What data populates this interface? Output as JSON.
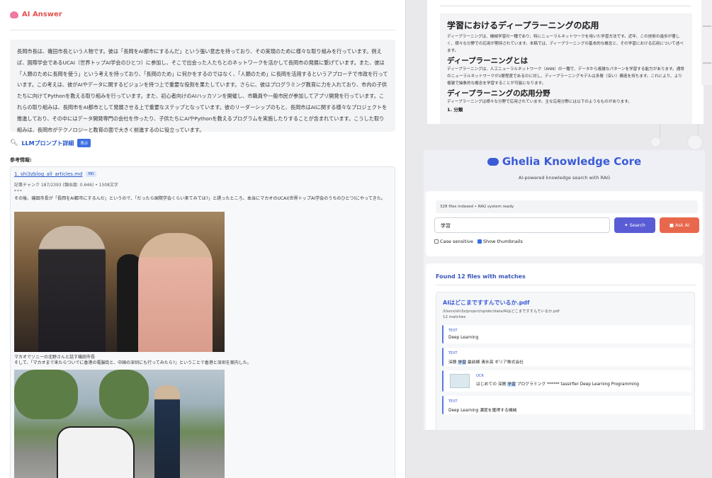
{
  "left": {
    "ai_title": "AI Answer",
    "answer": "長岡市長は、磯田市長という人物です。彼は「長岡をAI都市にするんだ」という強い意志を持っており、その実現のために様々な取り組みを行っています。例えば、国際学会であるUCAI（世界トップAI学会のひとつ）に参加し、そこで出会った人たちとのネットワークを活かして長岡市の発展に繋げています。また、彼は「人類のために長岡を使う」という考えを持っており、「長岡のため」に何かをするのではなく、「人類のため」に長岡を活用するというアプローチで市政を行っています。この考えは、彼がAIやデータに関するビジョンを持つ上で重要な役割を果たしています。さらに、彼はプログラミング教育に力を入れており、市内の子供たちに向けてPythonを教える取り組みを行っています。また、初心者向けのAIハッカソンを開催し、市職員や一般市民が参加してアプリ開発を行っています。これらの取り組みは、長岡市をAI都市として発展させる上で重要なステップとなっています。彼のリーダーシップのもと、長岡市はAIに関する様々なプロジェクトを推進しており、その中にはデータ開発専門の会社を作ったり、子供たちにAIやPythonを教えるプログラムを実施したりすることが含まれています。こうした取り組みは、長岡市がテクノロジーと教育の面で大きく前進するのに役立っています。",
    "prompt_label": "LLMプロンプト詳細",
    "show_label": "表示",
    "ref_heading": "参考情報:",
    "ref_link": "1. shi3zblog_all_articles.md",
    "ref_badge": "MD",
    "ref_meta": "記事チャンク 187/2393 (類似度: 0.646) • 1508文字",
    "ref_dots": "***",
    "ref_excerpt": "その後、磯田市長が「長岡をAI都市にするんだ」というので、「だったら国際学会くらい来てみては?」と誘ったところ、本当にマカオのUCAI(世界トップAI学会のうちのひとつ)にやってきた。",
    "caption1": "マカオでソニーの北野さんと話す磯田市長",
    "caption2": "そして、「マカオまで来たらついでに香港の電脳街と、中国の深圳にも行ってみたら?」ということで香港と深圳を案内した。"
  },
  "doc": {
    "h1": "学習におけるディープラーニングの応用",
    "p1": "ディープラーニングは、機械学習の一種であり、特にニューラルネットワークを用いた学習方法です。近年、この技術の進歩が著しく、様々な分野での応用が期待されています。本稿では、ディープラーニングの基本的な概念と、その学習における応用について述べます。",
    "h2a": "ディープラーニングとは",
    "p2": "ディープラーニングは、人工ニューラルネットワーク（ANN）の一種で、データから複雑なパターンを学習する能力があります。通常のニューラルネットワークが2層程度であるのに対し、ディープラーニングモデルは多層（深い）構造を持ちます。これにより、より複雑で抽象的な概念を学習することが可能になります。",
    "h2b": "ディープラーニングの応用分野",
    "p3": "ディープラーニングは様々な分野で応用されています。主な応用分野には以下のようなものがあります。",
    "h3": "1. 分類"
  },
  "ghelia": {
    "title": "Ghelia Knowledge Core",
    "subtitle": "AI-powered knowledge search with RAG",
    "status": "328 files indexed • RAG system ready",
    "query": "学習",
    "search_label": "Search",
    "ask_label": "Ask AI",
    "opt_case": "Case sensitive",
    "opt_thumbs": "Show thumbnails",
    "found": "Found 12 files with matches",
    "file_title": "AIはどこまですすんでいるか.pdf",
    "file_path": "/Users/shi3z/project/spider/data/AIはどこまですすんでいるか.pdf",
    "file_matches": "12 matches",
    "matches": [
      {
        "type": "TEXT",
        "text": "Deep Learning"
      },
      {
        "type": "TEXT",
        "pre": "深層 ",
        "hl": "学習",
        "post": " 最前線 清水亮 ギリア株式会社"
      },
      {
        "type": "OCR",
        "pre": "はじめての 深層 ",
        "hl": "学習",
        "post": " プログラミング ****** tassirfier Deep Learning Programming"
      },
      {
        "type": "TEXT",
        "text": "Deep Learning 濃度を獲得する機械"
      }
    ]
  },
  "colors": {
    "accent": "#3b5bd6",
    "ai_red": "#e0524f",
    "search_btn": "#5a5cd6",
    "ask_btn": "#e8684d"
  }
}
